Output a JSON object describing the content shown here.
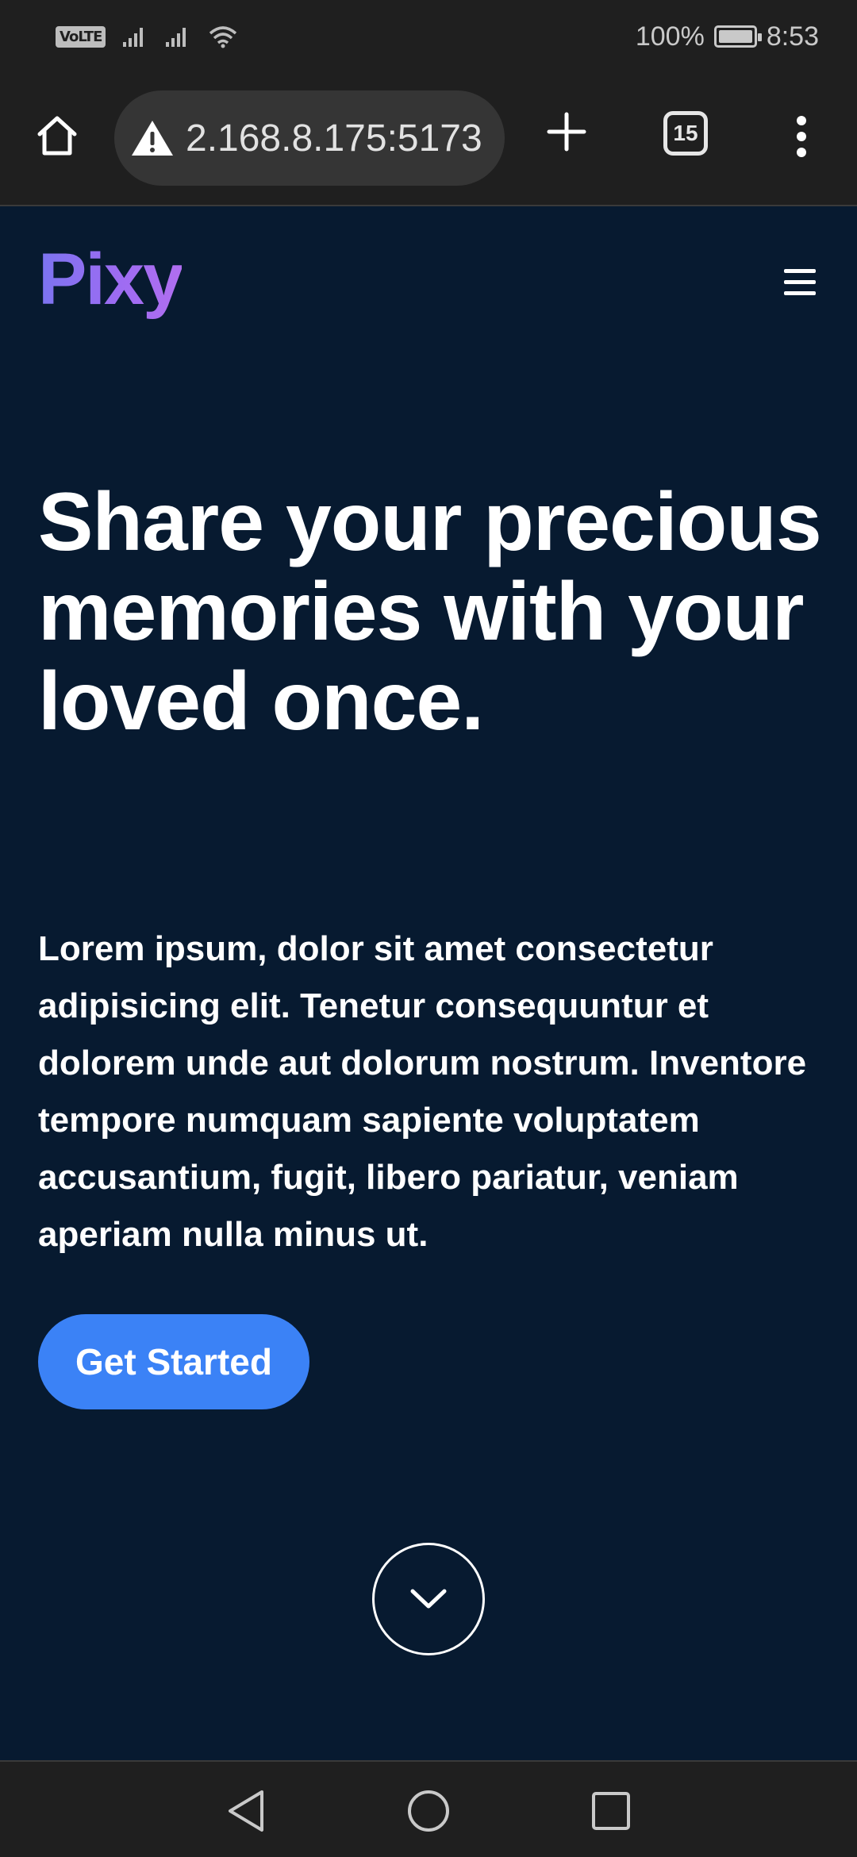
{
  "status_bar": {
    "volte_label": "VoLTE",
    "battery_percent": "100%",
    "time": "8:53"
  },
  "browser": {
    "url": "2.168.8.175:5173",
    "tab_count": "15"
  },
  "page": {
    "logo": "Pixy",
    "hero_title": "Share your precious memories with your loved once.",
    "hero_text": "Lorem ipsum, dolor sit amet consectetur adipisicing elit. Tenetur consequuntur et dolorem unde aut dolorum nostrum. Inventore tempore numquam sapiente voluptatem accusantium, fugit, libero pariatur, veniam aperiam nulla minus ut.",
    "cta_label": "Get Started"
  },
  "colors": {
    "page_background": "#071a30",
    "cta": "#3b82f6",
    "logo_gradient_start": "#7b74f0",
    "logo_gradient_end": "#b06ef0",
    "system_bar": "#1f1f1f"
  }
}
